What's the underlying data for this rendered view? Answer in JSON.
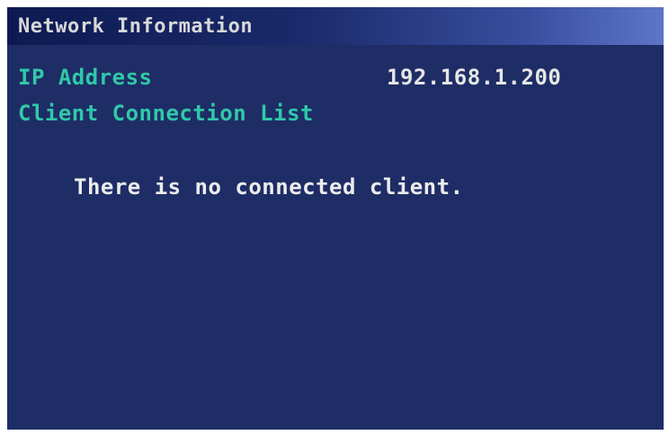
{
  "window": {
    "title": "Network Information"
  },
  "network": {
    "ip_label": "IP Address",
    "ip_value": "192.168.1.200",
    "client_list_label": "Client Connection List",
    "empty_message": "There is no connected client."
  },
  "colors": {
    "background": "#1e2d66",
    "label": "#30c8a8",
    "value": "#e6e6e6",
    "title_bar_end": "#5e75c8"
  }
}
